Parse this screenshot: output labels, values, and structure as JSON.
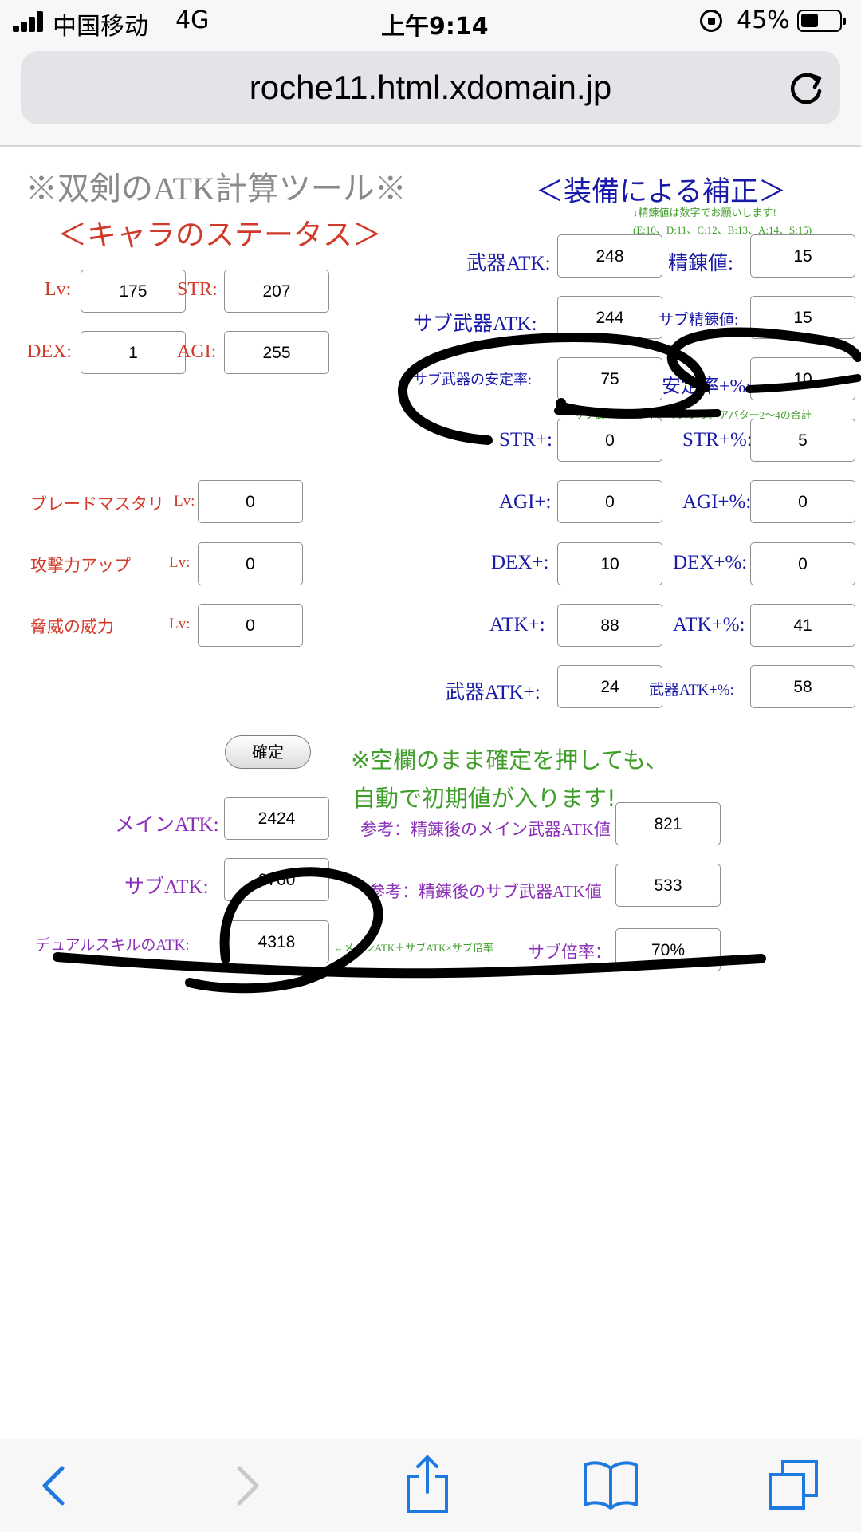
{
  "status_bar": {
    "carrier": "中国移动",
    "network": "4G",
    "time": "上午9:14",
    "battery": "45%"
  },
  "browser": {
    "url": "roche11.html.xdomain.jp"
  },
  "page": {
    "title": "※双剣のATK計算ツール※",
    "char_heading": "＜キャラのステータス＞",
    "equip_heading": "＜装備による補正＞",
    "refine_note1": "↓精錬値は数字でお願いします!",
    "refine_note2": "(E:10、D:11、C:12、B:13、A:14、S:15)",
    "stability_note": "サブ武器の安定率。マスタリ、アバター2〜4の合計",
    "char": {
      "lv_label": "Lv:",
      "lv": "175",
      "str_label": "STR:",
      "str": "207",
      "dex_label": "DEX:",
      "dex": "1",
      "agi_label": "AGI:",
      "agi": "255"
    },
    "skills": [
      {
        "name": "ブレードマスタリ",
        "lv_label": "Lv:",
        "value": "0"
      },
      {
        "name": "攻撃力アップ",
        "lv_label": "Lv:",
        "value": "0"
      },
      {
        "name": "脅威の威力",
        "lv_label": "Lv:",
        "value": "0"
      }
    ],
    "equip": {
      "weapon_atk_label": "武器ATK:",
      "weapon_atk": "248",
      "refine_label": "精錬値:",
      "refine": "15",
      "sub_weapon_atk_label": "サブ武器ATK:",
      "sub_weapon_atk": "244",
      "sub_refine_label": "サブ精錬値:",
      "sub_refine": "15",
      "sub_stability_label": "サブ武器の安定率:",
      "sub_stability": "75",
      "stability_pct_label": "安定率+%:",
      "stability_pct": "10",
      "str_plus_label": "STR+:",
      "str_plus": "0",
      "str_pct_label": "STR+%:",
      "str_pct": "5",
      "agi_plus_label": "AGI+:",
      "agi_plus": "0",
      "agi_pct_label": "AGI+%:",
      "agi_pct": "0",
      "dex_plus_label": "DEX+:",
      "dex_plus": "10",
      "dex_pct_label": "DEX+%:",
      "dex_pct": "0",
      "atk_plus_label": "ATK+:",
      "atk_plus": "88",
      "atk_pct_label": "ATK+%:",
      "atk_pct": "41",
      "weapon_atk_plus_label": "武器ATK+:",
      "weapon_atk_plus": "24",
      "weapon_atk_pct_label": "武器ATK+%:",
      "weapon_atk_pct": "58"
    },
    "confirm_button": "確定",
    "notice_line1": "※空欄のまま確定を押しても、",
    "notice_line2": "自動で初期値が入ります!",
    "results": {
      "main_atk_label": "メインATK:",
      "main_atk": "2424",
      "sub_atk_label": "サブATK:",
      "sub_atk": "2700",
      "dual_atk_label": "デュアルスキルのATK:",
      "dual_atk": "4318",
      "formula": "←メインATK＋サブATK×サブ倍率",
      "ref_main_label": "参考：精錬後のメイン武器ATK値",
      "ref_main": "821",
      "ref_sub_label": "参考：精錬後のサブ武器ATK値",
      "ref_sub": "533",
      "sub_ratio_label": "サブ倍率：",
      "sub_ratio": "70%"
    }
  },
  "colors": {
    "red": "#d03a2a",
    "blue": "#1a1aa8",
    "purple": "#8a2fb7",
    "green": "#3f9e2a",
    "ios_blue": "#1f7ae0"
  },
  "toolbar_icons": [
    "back-icon",
    "forward-icon",
    "share-icon",
    "bookmarks-icon",
    "tabs-icon"
  ]
}
